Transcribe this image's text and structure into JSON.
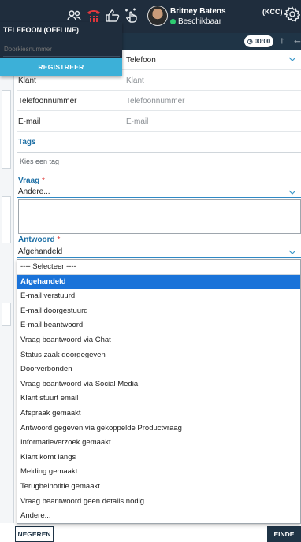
{
  "header": {
    "agent_name": "Britney Batens",
    "agent_status": "Beschikbaar",
    "org_label": "(KCC)",
    "icons": [
      "people-icon",
      "phone-grid-icon",
      "thumbs-up-icon",
      "hand-pointer-icon",
      "gear-icon"
    ],
    "status_color": "#2ecc71"
  },
  "toolbar": {
    "timer": "00:00"
  },
  "phone_panel": {
    "title": "TELEFOON (OFFLINE)",
    "number_placeholder": "Doorkiesnummer",
    "register_label": "REGISTREER"
  },
  "form": {
    "channel_value": "Telefoon",
    "customer_label": "Klant",
    "customer_placeholder": "Klant",
    "phone_label": "Telefoonnummer",
    "phone_placeholder": "Telefoonnummer",
    "email_label": "E-mail",
    "email_placeholder": "E-mail",
    "tags_label": "Tags",
    "tags_placeholder": "Kies een tag",
    "question_label": "Vraag",
    "question_value": "Andere...",
    "answer_label": "Antwoord",
    "answer_value": "Afgehandeld",
    "required_mark": "*"
  },
  "answer_options": [
    "---- Selecteer ----",
    "Afgehandeld",
    "E-mail verstuurd",
    "E-mail doorgestuurd",
    "E-mail beantwoord",
    "Vraag beantwoord via Chat",
    "Status zaak doorgegeven",
    "Doorverbonden",
    "Vraag beantwoord via Social Media",
    "Klant stuurt email",
    "Afspraak gemaakt",
    "Antwoord gegeven via gekoppelde Productvraag",
    "Informatieverzoek gemaakt",
    "Klant komt langs",
    "Melding gemaakt",
    "Terugbelnotitie gemaakt",
    "Vraag beantwoord geen details nodig",
    "Andere..."
  ],
  "selected_option": "Afgehandeld",
  "footer": {
    "cancel_label": "NEGEREN",
    "end_label": "EINDE"
  },
  "colors": {
    "header_bg": "#1f2d3d",
    "accent": "#3cb0d8",
    "selected": "#1a73d9",
    "section_label": "#1d6fa5"
  }
}
